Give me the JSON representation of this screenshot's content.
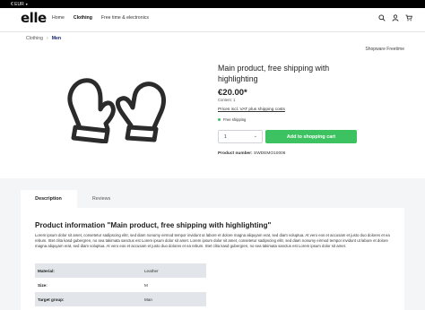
{
  "topbar": {
    "currency": "€ EUR"
  },
  "header": {
    "logo": "elle",
    "nav": [
      "Home",
      "Clothing",
      "Free time & electronics"
    ],
    "active_nav": "Clothing"
  },
  "breadcrumb": {
    "items": [
      "Clothing",
      "Men"
    ]
  },
  "manufacturer": "Shopware Freetime",
  "product": {
    "title": "Main product, free shipping with highlighting",
    "price": "€20.00*",
    "content": "Content: 1",
    "tax_link": "Prices incl. VAT plus shipping costs",
    "shipping": "Free shipping",
    "quantity": "1",
    "add_to_cart": "Add to shopping cart",
    "number_label": "Product number:",
    "number_value": "SWDEMO10006"
  },
  "tabs": [
    "Description",
    "Reviews"
  ],
  "description": {
    "heading": "Product information \"Main product, free shipping with highlighting\"",
    "body": "Lorem ipsum dolor sit amet, consetetur sadipscing elitr, sed diam nonumy eirmod tempor invidunt ut labore et dolore magna aliquyam erat, sed diam voluptua. At vero eos et accusam et justo duo dolores et ea rebum. Stet clita kasd gubergren, no sea takimata sanctus est Lorem ipsum dolor sit amet. Lorem ipsum dolor sit amet, consetetur sadipscing elitr, sed diam nonumy eirmod tempor invidunt ut labore et dolore magna aliquyam erat, sed diam voluptua. At vero eos et accusam et justo duo dolores et ea rebum. Stet clita kasd gubergren, no sea takimata sanctus est Lorem ipsum dolor sit amet."
  },
  "properties": [
    {
      "label": "Material:",
      "value": "Leather"
    },
    {
      "label": "Size:",
      "value": "M"
    },
    {
      "label": "Target group:",
      "value": "Man"
    }
  ],
  "colors": {
    "accent_green": "#3cc261",
    "breadcrumb_active": "#1a2a6c"
  },
  "icons": [
    "search-icon",
    "user-icon",
    "cart-icon",
    "chevron-down-icon",
    "mittens-icon"
  ]
}
